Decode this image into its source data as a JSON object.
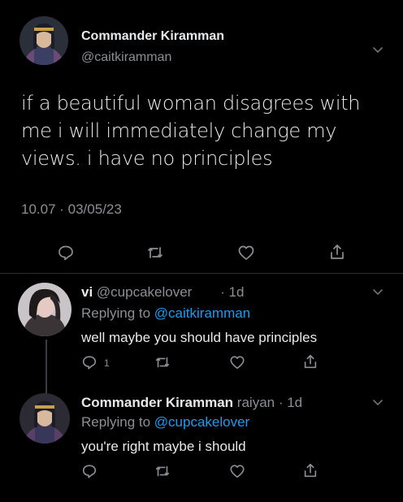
{
  "main_tweet": {
    "display_name": "Commander Kiramman",
    "handle": "@caitkiramman",
    "text": "if a beautiful woman disagrees with me i will immediately change my views. i have no principles",
    "timestamp": "10.07 · 03/05/23",
    "icons": [
      "chevron-down-icon",
      "reply-icon",
      "retweet-icon",
      "like-icon",
      "share-icon"
    ]
  },
  "replies": [
    {
      "display_name": "vi",
      "handle": "@cupcakelover",
      "separator": "·",
      "time": "1d",
      "replying_label": "Replying to",
      "replying_to": "@caitkiramman",
      "text": "well maybe you should have principles",
      "reply_count": "1"
    },
    {
      "display_name": "Commander Kiramman",
      "handle": "raiyan · 1d",
      "replying_label": "Replying to",
      "replying_to": "@cupcakelover",
      "text": "you're right maybe i should"
    }
  ],
  "colors": {
    "background": "#000000",
    "text": "#e7e9ea",
    "secondary": "#8b8f94",
    "link": "#1d9bf0"
  }
}
